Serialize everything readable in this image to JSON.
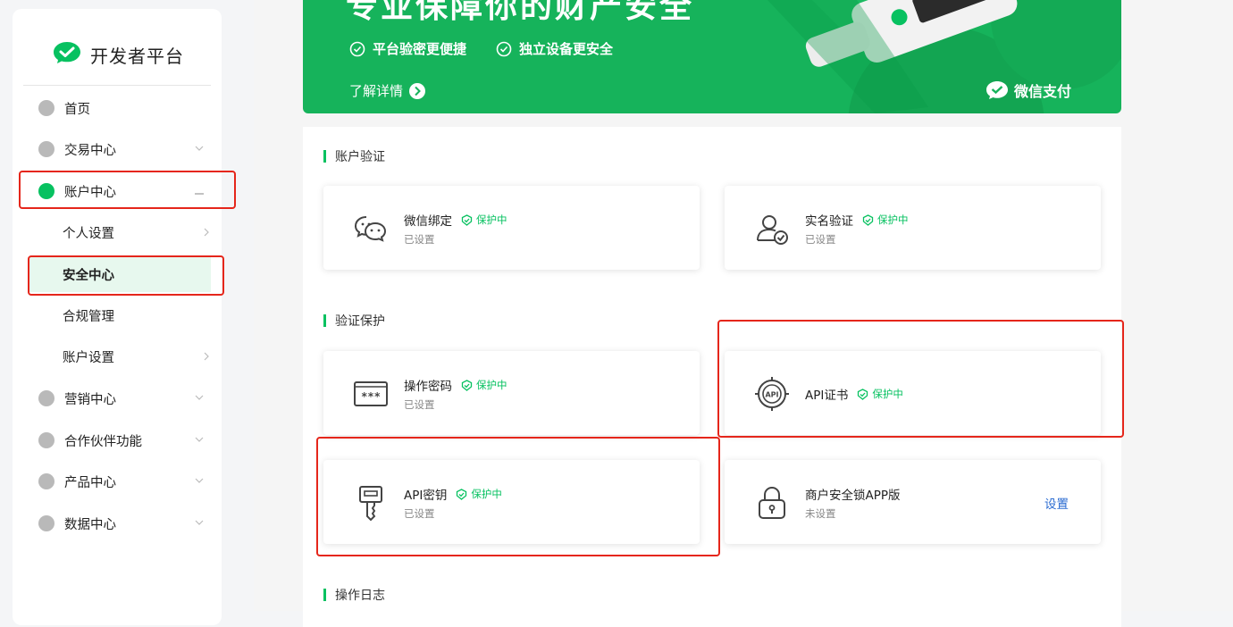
{
  "sidebar": {
    "brand": "开发者平台",
    "items": [
      {
        "label": "首页"
      },
      {
        "label": "交易中心"
      },
      {
        "label": "账户中心"
      },
      {
        "label": "个人设置"
      },
      {
        "label": "安全中心"
      },
      {
        "label": "合规管理"
      },
      {
        "label": "账户设置"
      },
      {
        "label": "营销中心"
      },
      {
        "label": "合作伙伴功能"
      },
      {
        "label": "产品中心"
      },
      {
        "label": "数据中心"
      }
    ]
  },
  "banner": {
    "title": "专业保障你的财产安全",
    "feature_1": "平台验密更便捷",
    "feature_2": "独立设备更安全",
    "more": "了解详情",
    "brand": "微信支付"
  },
  "sections": [
    {
      "title": "账户验证"
    },
    {
      "title": "验证保护"
    },
    {
      "title": "操作日志"
    }
  ],
  "cards": [
    {
      "title": "微信绑定",
      "status": "保护中",
      "sub": "已设置",
      "icon": "wechat-icon"
    },
    {
      "title": "实名验证",
      "status": "保护中",
      "sub": "已设置",
      "icon": "user-verify-icon"
    },
    {
      "title": "操作密码",
      "status": "保护中",
      "sub": "已设置",
      "icon": "password-icon"
    },
    {
      "title": "API证书",
      "status": "保护中",
      "icon": "api-cert-icon"
    },
    {
      "title": "API密钥",
      "status": "保护中",
      "sub": "已设置",
      "icon": "key-icon"
    },
    {
      "title": "商户安全锁APP版",
      "sub": "未设置",
      "action": "设置",
      "icon": "lock-icon"
    }
  ],
  "colors": {
    "accent": "#07c160",
    "highlight": "#e5261b",
    "link": "#2a6bd1"
  }
}
